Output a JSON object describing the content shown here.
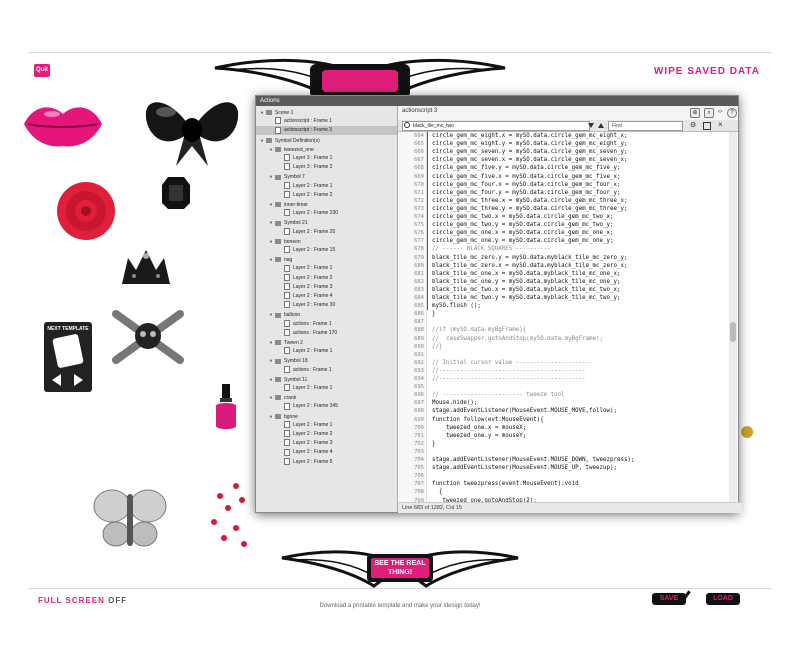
{
  "header": {
    "quit_label": "Quit",
    "wipe_label": "WIPE SAVED DATA"
  },
  "footer": {
    "full_screen_label": "FULL SCREEN",
    "full_screen_state": "OFF",
    "download_text": "Download a printable template and make your idesign today!",
    "save_label": "SAVE",
    "load_label": "LOAD",
    "cta_label": "SEE THE REAL THING!"
  },
  "template_card": {
    "title": "NEXT TEMPLATE"
  },
  "actions_panel": {
    "title": "Actions",
    "tab_label": "actionscript 3",
    "search_value": "black_tile_mc_two",
    "find_placeholder": "Find",
    "status_text": "Line 683 of 1282, Col 15",
    "tree": [
      {
        "label": "Scene 1",
        "level": 0,
        "kind": "scene",
        "arrow": true
      },
      {
        "label": "actionscript : Frame 1",
        "level": 1,
        "kind": "frame"
      },
      {
        "label": "actionscript : Frame 3",
        "level": 1,
        "kind": "frame",
        "selected": true
      },
      {
        "label": "Symbol Definition(s)",
        "level": 0,
        "kind": "symbols",
        "arrow": true
      },
      {
        "label": "tweezed_one",
        "level": 1,
        "kind": "symbol",
        "arrow": true
      },
      {
        "label": "Layer 3 : Frame 1",
        "level": 2,
        "kind": "frame"
      },
      {
        "label": "Layer 3 : Frame 2",
        "level": 2,
        "kind": "frame"
      },
      {
        "label": "Symbol 7",
        "level": 1,
        "kind": "symbol",
        "arrow": true
      },
      {
        "label": "Layer 2 : Frame 1",
        "level": 2,
        "kind": "frame"
      },
      {
        "label": "Layer 2 : Frame 2",
        "level": 2,
        "kind": "frame"
      },
      {
        "label": "inner-timer",
        "level": 1,
        "kind": "symbol",
        "arrow": true
      },
      {
        "label": "Layer 2 : Frame 230",
        "level": 2,
        "kind": "frame"
      },
      {
        "label": "Symbol 21",
        "level": 1,
        "kind": "symbol",
        "arrow": true
      },
      {
        "label": "Layer 2 : Frame 20",
        "level": 2,
        "kind": "frame"
      },
      {
        "label": "boneon",
        "level": 1,
        "kind": "symbol",
        "arrow": true
      },
      {
        "label": "Layer 2 : Frame 15",
        "level": 2,
        "kind": "frame"
      },
      {
        "label": "nag",
        "level": 1,
        "kind": "symbol",
        "arrow": true
      },
      {
        "label": "Layer 2 : Frame 1",
        "level": 2,
        "kind": "frame"
      },
      {
        "label": "Layer 2 : Frame 2",
        "level": 2,
        "kind": "frame"
      },
      {
        "label": "Layer 2 : Frame 3",
        "level": 2,
        "kind": "frame"
      },
      {
        "label": "Layer 2 : Frame 4",
        "level": 2,
        "kind": "frame"
      },
      {
        "label": "Layer 2 : Frame 30",
        "level": 2,
        "kind": "frame"
      },
      {
        "label": "balloon",
        "level": 1,
        "kind": "symbol",
        "arrow": true
      },
      {
        "label": "actions : Frame 1",
        "level": 2,
        "kind": "frame"
      },
      {
        "label": "actions : Frame 170",
        "level": 2,
        "kind": "frame"
      },
      {
        "label": "Tween 2",
        "level": 1,
        "kind": "symbol",
        "arrow": true
      },
      {
        "label": "Layer 2 : Frame 1",
        "level": 2,
        "kind": "frame"
      },
      {
        "label": "Symbol 18",
        "level": 1,
        "kind": "symbol",
        "arrow": true
      },
      {
        "label": "actions : Frame 1",
        "level": 2,
        "kind": "frame"
      },
      {
        "label": "Symbol 11",
        "level": 1,
        "kind": "symbol",
        "arrow": true
      },
      {
        "label": "Layer 2 : Frame 1",
        "level": 2,
        "kind": "frame"
      },
      {
        "label": "crank",
        "level": 1,
        "kind": "symbol",
        "arrow": true
      },
      {
        "label": "Layer 2 : Frame 345",
        "level": 2,
        "kind": "frame"
      },
      {
        "label": "bgone",
        "level": 1,
        "kind": "symbol",
        "arrow": true
      },
      {
        "label": "Layer 2 : Frame 1",
        "level": 2,
        "kind": "frame"
      },
      {
        "label": "Layer 2 : Frame 2",
        "level": 2,
        "kind": "frame"
      },
      {
        "label": "Layer 2 : Frame 3",
        "level": 2,
        "kind": "frame"
      },
      {
        "label": "Layer 2 : Frame 4",
        "level": 2,
        "kind": "frame"
      },
      {
        "label": "Layer 2 : Frame 5",
        "level": 2,
        "kind": "frame"
      }
    ],
    "code_lines": [
      {
        "n": 664,
        "t": "circle_gem_mc_eight.x = mySO.data.circle_gem_mc_eight_x;"
      },
      {
        "n": 665,
        "t": "circle_gem_mc_eight.y = mySO.data.circle_gem_mc_eight_y;"
      },
      {
        "n": 666,
        "t": "circle_gem_mc_seven.y = mySO.data.circle_gem_mc_seven_y;"
      },
      {
        "n": 667,
        "t": "circle_gem_mc_seven.x = mySO.data.circle_gem_mc_seven_x;"
      },
      {
        "n": 668,
        "t": "circle_gem_mc_five.y = mySO.data.circle_gem_mc_five_y;"
      },
      {
        "n": 669,
        "t": "circle_gem_mc_five.x = mySO.data.circle_gem_mc_five_x;"
      },
      {
        "n": 670,
        "t": "circle_gem_mc_four.x = mySO.data.circle_gem_mc_four_x;"
      },
      {
        "n": 671,
        "t": "circle_gem_mc_four.y = mySO.data.circle_gem_mc_four_y;"
      },
      {
        "n": 672,
        "t": "circle_gem_mc_three.x = mySO.data.circle_gem_mc_three_x;"
      },
      {
        "n": 673,
        "t": "circle_gem_mc_three.y = mySO.data.circle_gem_mc_three_y;"
      },
      {
        "n": 674,
        "t": "circle_gem_mc_two.x = mySO.data.circle_gem_mc_two_x;"
      },
      {
        "n": 675,
        "t": "circle_gem_mc_two.y = mySO.data.circle_gem_mc_two_y;"
      },
      {
        "n": 676,
        "t": "circle_gem_mc_one.x = mySO.data.circle_gem_mc_one_x;"
      },
      {
        "n": 677,
        "t": "circle_gem_mc_one.y = mySO.data.circle_gem_mc_one_y;"
      },
      {
        "n": 678,
        "t": "// ------ BLACK SQUARES ----------",
        "comment": true
      },
      {
        "n": 679,
        "t": "black_tile_mc_zero.y = mySO.data.myblack_tile_mc_zero_y;"
      },
      {
        "n": 680,
        "t": "black_tile_mc_zero.x = mySO.data.myblack_tile_mc_zero_x;"
      },
      {
        "n": 681,
        "t": "black_tile_mc_one.x = mySO.data.myblack_tile_mc_one_x;"
      },
      {
        "n": 682,
        "t": "black_tile_mc_one.y = mySO.data.myblack_tile_mc_one_y;"
      },
      {
        "n": 683,
        "t": "black_tile_mc_two.x = mySO.data.myblack_tile_mc_two_x;"
      },
      {
        "n": 684,
        "t": "black_tile_mc_two.y = mySO.data.myblack_tile_mc_two_y;"
      },
      {
        "n": 685,
        "t": "mySO.flush ();"
      },
      {
        "n": 686,
        "t": "}"
      },
      {
        "n": 687,
        "t": ""
      },
      {
        "n": 688,
        "t": "//if (mySO.data.myBgFrame){",
        "comment": true
      },
      {
        "n": 689,
        "t": "//  caseSwapper.gotoAndStop(mySO.data.myBgFrame);",
        "comment": true
      },
      {
        "n": 690,
        "t": "//}",
        "comment": true
      },
      {
        "n": 691,
        "t": ""
      },
      {
        "n": 692,
        "t": "// Initial cursor value ----------------------",
        "comment": true
      },
      {
        "n": 693,
        "t": "//------------------------------------------",
        "comment": true
      },
      {
        "n": 694,
        "t": "//------------------------------------------",
        "comment": true
      },
      {
        "n": 695,
        "t": ""
      },
      {
        "n": 696,
        "t": "// ----------------------- tweeze tool",
        "comment": true
      },
      {
        "n": 697,
        "t": "Mouse.hide();"
      },
      {
        "n": 698,
        "t": "stage.addEventListener(MouseEvent.MOUSE_MOVE,follow);"
      },
      {
        "n": 699,
        "t": "function follow(evt:MouseEvent){"
      },
      {
        "n": 700,
        "t": "    tweezed_one.x = mouseX;"
      },
      {
        "n": 701,
        "t": "    tweezed_one.y = mouseY;"
      },
      {
        "n": 702,
        "t": "}"
      },
      {
        "n": 703,
        "t": ""
      },
      {
        "n": 704,
        "t": "stage.addEventListener(MouseEvent.MOUSE_DOWN, tweezpress);"
      },
      {
        "n": 705,
        "t": "stage.addEventListener(MouseEvent.MOUSE_UP, tweezup);"
      },
      {
        "n": 706,
        "t": ""
      },
      {
        "n": 707,
        "t": "function tweezpress(event:MouseEvent):void"
      },
      {
        "n": 708,
        "t": "  {"
      },
      {
        "n": 709,
        "t": "   tweezed_one.gotoAndStop(2);"
      },
      {
        "n": 710,
        "t": "  }"
      }
    ]
  },
  "colors": {
    "accent": "#e01f7a",
    "dark": "#111111"
  }
}
